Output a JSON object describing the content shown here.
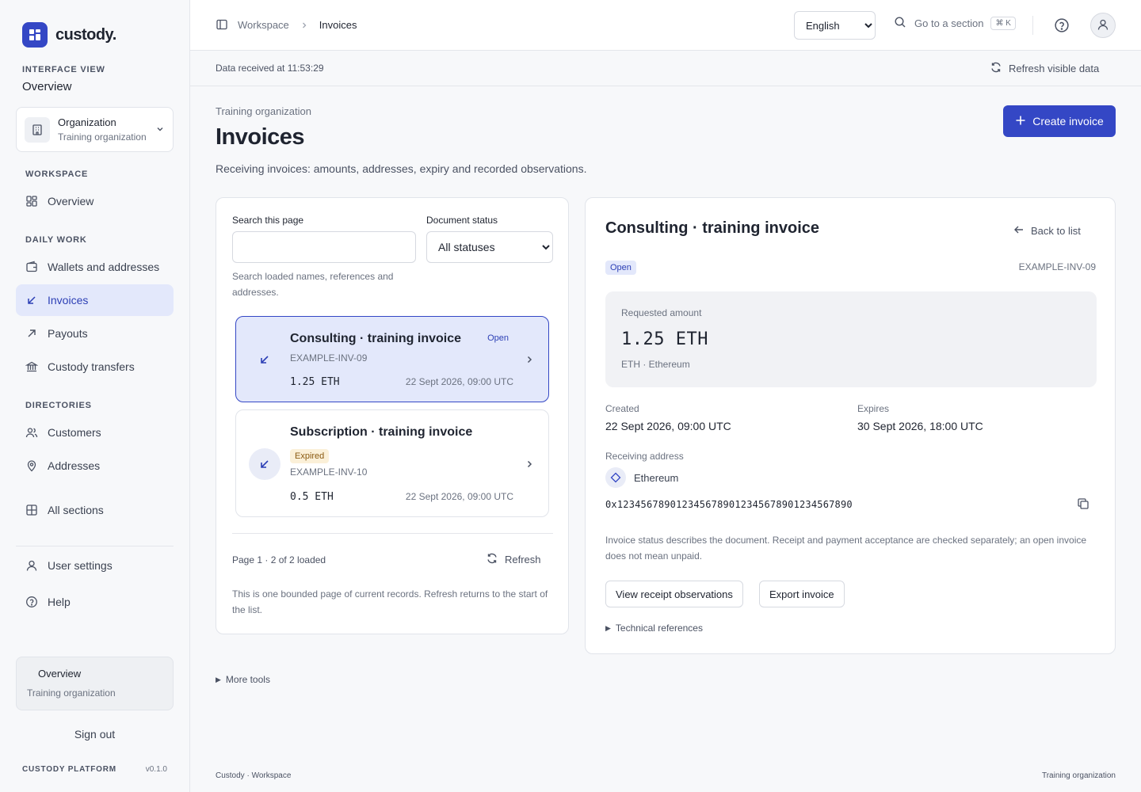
{
  "brand": {
    "name": "custody."
  },
  "sidebar": {
    "interface_view_label": "INTERFACE VIEW",
    "interface_view_value": "Overview",
    "org": {
      "title": "Organization",
      "subtitle": "Training organization"
    },
    "sections": [
      {
        "label": "WORKSPACE"
      },
      {
        "label": "DAILY WORK"
      },
      {
        "label": "DIRECTORIES"
      }
    ],
    "items": [
      {
        "label": "Overview",
        "icon": "grid-icon"
      },
      {
        "label": "Wallets and addresses",
        "icon": "wallet-icon"
      },
      {
        "label": "Invoices",
        "icon": "arrow-down-left-icon",
        "active": true
      },
      {
        "label": "Payouts",
        "icon": "arrow-up-right-icon"
      },
      {
        "label": "Custody transfers",
        "icon": "bank-icon"
      },
      {
        "label": "Customers",
        "icon": "users-icon"
      },
      {
        "label": "Addresses",
        "icon": "map-pin-icon"
      },
      {
        "label": "All sections",
        "icon": "sections-grid-icon"
      },
      {
        "label": "User settings",
        "icon": "user-icon"
      },
      {
        "label": "Help",
        "icon": "help-circle-icon"
      }
    ],
    "context_card": {
      "title": "Overview",
      "subtitle": "Training organization"
    },
    "sign_out": "Sign out",
    "footer": {
      "platform": "CUSTODY PLATFORM",
      "version": "v0.1.0"
    }
  },
  "topbar": {
    "breadcrumb": [
      "Workspace",
      "Invoices"
    ],
    "language": {
      "selected": "English",
      "options": [
        "English"
      ]
    },
    "goto": {
      "label": "Go to a section",
      "shortcut": "⌘ K"
    }
  },
  "databar": {
    "received": "Data received at 11:53:29",
    "refresh_label": "Refresh visible data"
  },
  "header": {
    "kicker": "Training organization",
    "title": "Invoices",
    "description": "Receiving invoices: amounts, addresses, expiry and recorded observations.",
    "create_label": "Create invoice"
  },
  "list": {
    "search_label": "Search this page",
    "search_value": "",
    "search_hint": "Search loaded names, references and addresses.",
    "status_label": "Document status",
    "status_selected": "All statuses",
    "status_options": [
      "All statuses"
    ],
    "invoices": [
      {
        "title": "Consulting · training invoice",
        "status": "Open",
        "ref": "EXAMPLE-INV-09",
        "amount": "1.25 ETH",
        "date": "22 Sept 2026, 09:00 UTC"
      },
      {
        "title": "Subscription · training invoice",
        "status": "Expired",
        "ref": "EXAMPLE-INV-10",
        "amount": "0.5 ETH",
        "date": "22 Sept 2026, 09:00 UTC"
      }
    ],
    "page_info": "Page 1 · 2 of 2 loaded",
    "refresh_label": "Refresh",
    "note": "This is one bounded page of current records. Refresh returns to the start of the list."
  },
  "detail": {
    "title": "Consulting · training invoice",
    "back_label": "Back to list",
    "status": "Open",
    "ref": "EXAMPLE-INV-09",
    "amount_label": "Requested amount",
    "amount": "1.25 ETH",
    "asset": "ETH · Ethereum",
    "created_label": "Created",
    "created": "22 Sept 2026, 09:00 UTC",
    "expires_label": "Expires",
    "expires": "30 Sept 2026, 18:00 UTC",
    "address_label": "Receiving address",
    "chain": "Ethereum",
    "address": "0x1234567890123456789012345678901234567890",
    "status_note": "Invoice status describes the document. Receipt and payment acceptance are checked separately; an open invoice does not mean unpaid.",
    "view_receipts_label": "View receipt observations",
    "export_label": "Export invoice",
    "tech_refs_label": "Technical references"
  },
  "more_tools_label": "More tools",
  "footer": {
    "left": "Custody · Workspace",
    "right": "Training organization"
  },
  "colors": {
    "accent": "#3447c5",
    "active_bg": "#e3e8fb",
    "expired_bg": "#fbf0d8",
    "expired_text": "#8a5a12"
  }
}
